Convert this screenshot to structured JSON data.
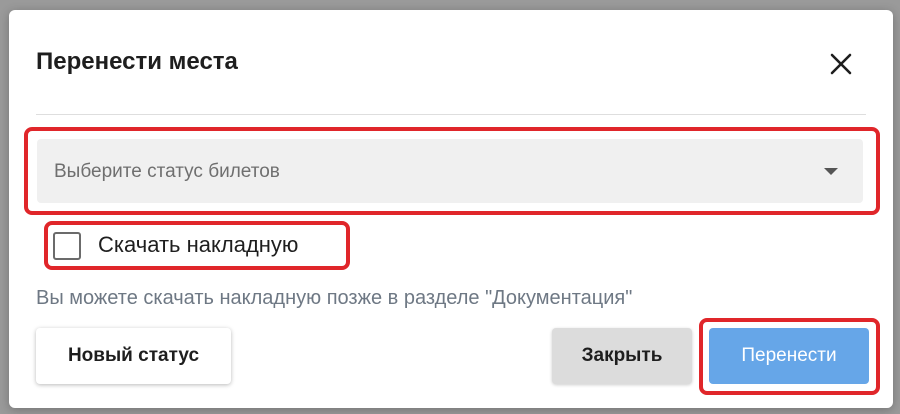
{
  "dialog": {
    "title": "Перенести места",
    "close_icon": "close-icon"
  },
  "status_select": {
    "placeholder": "Выберите статус билетов",
    "icon": "chevron-down-icon"
  },
  "download_invoice": {
    "label": "Скачать накладную",
    "checked": false
  },
  "hint_text": "Вы можете скачать накладную позже в разделе \"Документация\"",
  "buttons": {
    "new_status": "Новый статус",
    "close": "Закрыть",
    "move": "Перенести"
  },
  "colors": {
    "primary": "#66a6e8",
    "highlight": "#e0262a",
    "secondary_button": "#dcdcdc"
  }
}
